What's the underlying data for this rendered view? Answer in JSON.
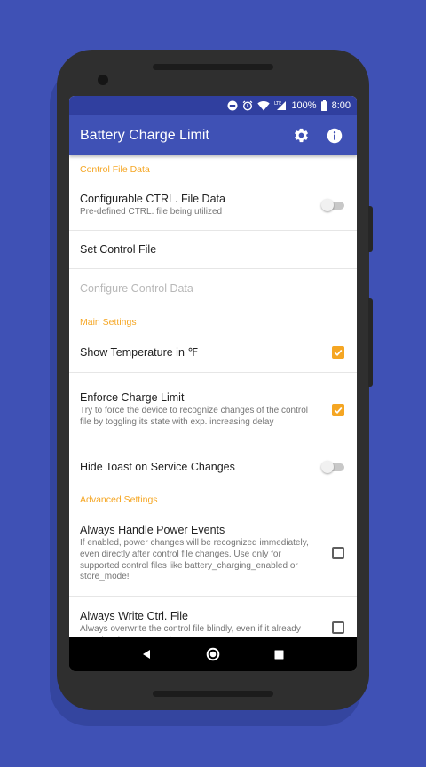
{
  "status_bar": {
    "battery_percent": "100%",
    "time": "8:00",
    "network_label": "LTE"
  },
  "app_bar": {
    "title": "Battery Charge Limit"
  },
  "sections": {
    "control_file": {
      "header": "Control File Data",
      "configurable_ctrl": {
        "title": "Configurable CTRL. File Data",
        "summary": "Pre-defined CTRL. file being utilized",
        "enabled": false
      },
      "set_control_file": {
        "title": "Set Control File"
      },
      "configure_control_data": {
        "title": "Configure Control Data",
        "disabled": true
      }
    },
    "main": {
      "header": "Main Settings",
      "show_temperature": {
        "title": "Show Temperature in ℉",
        "checked": true
      },
      "enforce_limit": {
        "title": "Enforce Charge Limit",
        "summary": "Try to force the device to recognize changes of the control file by toggling its state with exp. increasing delay",
        "checked": true
      },
      "hide_toast": {
        "title": "Hide Toast on Service Changes",
        "enabled": false
      }
    },
    "advanced": {
      "header": "Advanced Settings",
      "always_handle_power": {
        "title": "Always Handle Power Events",
        "summary": "If enabled, power changes will be recognized immediately, even directly after control file changes. Use only for supported control files like battery_charging_enabled or store_mode!",
        "checked": false
      },
      "always_write_ctrl": {
        "title": "Always Write Ctrl. File",
        "summary": "Always overwrite the control file blindly, even if it already contains the correct value",
        "checked": false
      }
    }
  },
  "colors": {
    "primary": "#3f51b5",
    "primary_dark": "#303f9f",
    "accent": "#f5a623",
    "background": "#3f51b5"
  }
}
